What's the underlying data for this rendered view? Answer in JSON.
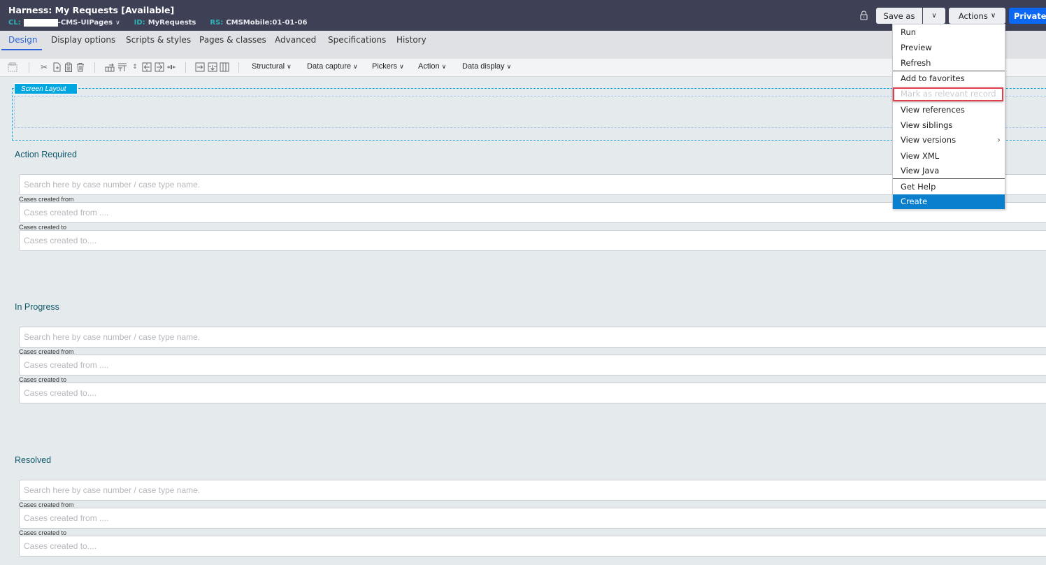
{
  "header": {
    "title": "Harness: My Requests [Available]",
    "cl_label": "CL:",
    "cl_value": "-CMS-UIPages",
    "id_label": "ID:",
    "id_value": "MyRequests",
    "rs_label": "RS:",
    "rs_value": "CMSMobile:01-01-06",
    "save_as_label": "Save as",
    "actions_label": "Actions",
    "private_label": "Private"
  },
  "tabs": [
    {
      "label": "Design",
      "active": true
    },
    {
      "label": "Display options"
    },
    {
      "label": "Scripts & styles"
    },
    {
      "label": "Pages & classes"
    },
    {
      "label": "Advanced"
    },
    {
      "label": "Specifications"
    },
    {
      "label": "History"
    }
  ],
  "toolbar": {
    "dropdowns": [
      "Structural",
      "Data capture",
      "Pickers",
      "Action",
      "Data display"
    ]
  },
  "screen_layout_label": "Screen Layout",
  "sections": [
    {
      "title": "Action Required",
      "search_placeholder": "Search here by case number / case type name.",
      "from_label": "Cases created from",
      "from_placeholder": "Cases created from ....",
      "to_label": "Cases created to",
      "to_placeholder": "Cases created to...."
    },
    {
      "title": "In Progress",
      "search_placeholder": "Search here by case number / case type name.",
      "from_label": "Cases created from",
      "from_placeholder": "Cases created from ....",
      "to_label": "Cases created to",
      "to_placeholder": "Cases created to...."
    },
    {
      "title": "Resolved",
      "search_placeholder": "Search here by case number / case type name.",
      "from_label": "Cases created from",
      "from_placeholder": "Cases created from ....",
      "to_label": "Cases created to",
      "to_placeholder": "Cases created to...."
    }
  ],
  "actions_menu": {
    "items": [
      {
        "label": "Run"
      },
      {
        "label": "Preview"
      },
      {
        "label": "Refresh"
      },
      {
        "label": "Add to favorites"
      },
      {
        "label": "Mark as relevant record",
        "disabled": true
      },
      {
        "label": "View references"
      },
      {
        "label": "View siblings"
      },
      {
        "label": "View versions",
        "submenu": true
      },
      {
        "label": "View XML"
      },
      {
        "label": "View Java"
      },
      {
        "label": "Get Help"
      },
      {
        "label": "Create",
        "highlighted": true
      }
    ]
  },
  "colors": {
    "header_bg": "#3e4055",
    "accent_blue": "#2a64d6",
    "private_button": "#0c67f2",
    "menu_highlight": "#0a7fce",
    "annotation_red": "#e0404a",
    "section_title": "#10596a"
  }
}
